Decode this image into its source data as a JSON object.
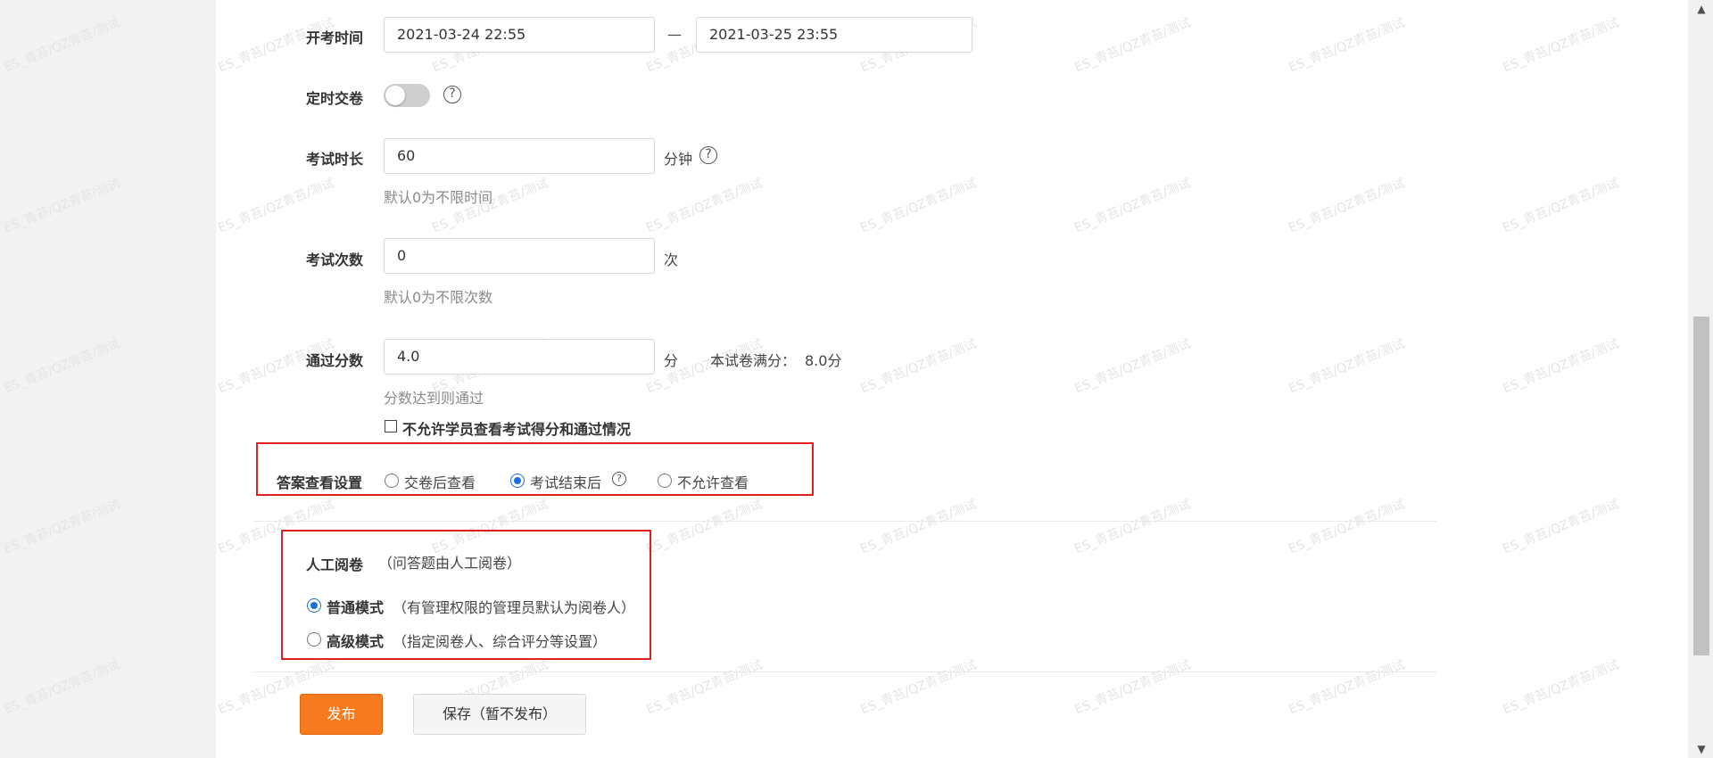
{
  "watermark_text": "ES_青苔/QZ青苔/测试",
  "form": {
    "exam_time": {
      "label": "开考时间",
      "start": "2021-03-24 22:55",
      "separator": "—",
      "end": "2021-03-25 23:55"
    },
    "timed_submit": {
      "label": "定时交卷",
      "enabled": false,
      "help": "?"
    },
    "duration": {
      "label": "考试时长",
      "value": "60",
      "unit": "分钟",
      "help": "?",
      "hint": "默认0为不限时间"
    },
    "attempts": {
      "label": "考试次数",
      "value": "0",
      "unit": "次",
      "hint": "默认0为不限次数"
    },
    "pass_score": {
      "label": "通过分数",
      "value": "4.0",
      "unit": "分",
      "full_score_label": "本试卷满分：",
      "full_score_value": "8.0分",
      "hint": "分数达到则通过"
    },
    "hide_score_checkbox": {
      "label": "不允许学员查看考试得分和通过情况",
      "checked": false
    },
    "answer_view": {
      "label": "答案查看设置",
      "help": "?",
      "options": [
        "交卷后查看",
        "考试结束后",
        "不允许查看"
      ],
      "selected": "考试结束后"
    },
    "manual_grading": {
      "label": "人工阅卷",
      "note": "（问答题由人工阅卷）",
      "options": [
        {
          "name": "普通模式",
          "desc": "（有管理权限的管理员默认为阅卷人）",
          "checked": true
        },
        {
          "name": "高级模式",
          "desc": "（指定阅卷人、综合评分等设置）",
          "checked": false
        }
      ]
    }
  },
  "actions": {
    "publish": "发布",
    "save_draft": "保存（暂不发布）"
  },
  "colors": {
    "accent": "#f77b1e",
    "radio": "#1a6fd8",
    "highlight": "#e02020"
  }
}
